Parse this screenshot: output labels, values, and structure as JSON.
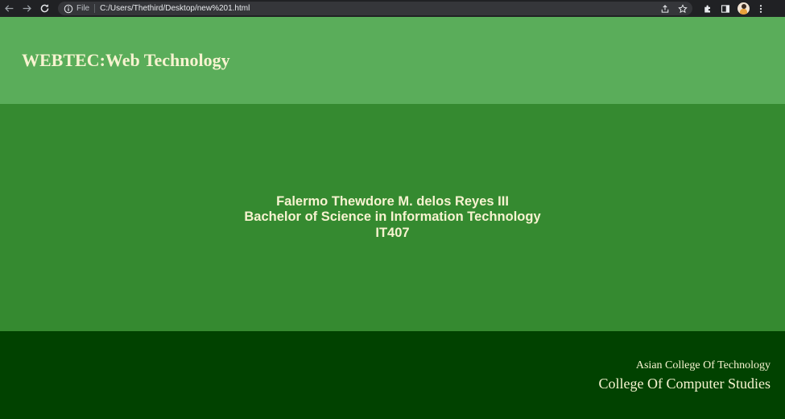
{
  "browser": {
    "scheme_label": "File",
    "url": "C:/Users/Thethird/Desktop/new%201.html",
    "icons": [
      "back-arrow-icon",
      "forward-arrow-icon",
      "reload-icon",
      "info-icon",
      "share-icon",
      "star-icon",
      "extensions-icon",
      "side-panel-icon",
      "profile-avatar",
      "menu-kebab-icon"
    ]
  },
  "header": {
    "title": "WEBTEC:Web Technology"
  },
  "main": {
    "name": "Falermo Thewdore M. delos Reyes III",
    "program": "Bachelor of Science in Information Technology",
    "section": "IT407"
  },
  "footer": {
    "school": "Asian College Of Technology",
    "college": "College Of Computer Studies"
  },
  "colors": {
    "browser_bar": "#202124",
    "header_bg": "#5aad5a",
    "main_bg": "#358a30",
    "footer_bg": "#014200",
    "text": "#f7f3d0"
  }
}
